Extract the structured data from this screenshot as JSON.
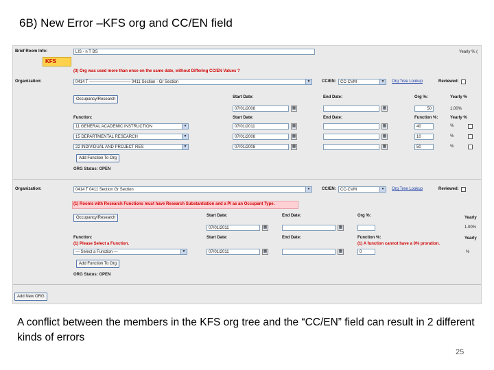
{
  "slide": {
    "title": "6B)   New Error –KFS org and CC/EN field",
    "caption": "A conflict between the members in the KFS org tree and the “CC/EN” field can result in 2 different kinds of errors",
    "page_number": "25"
  },
  "form": {
    "brief_room_info_label": "Brief Room Info:",
    "brief_room_info_value": "LIS - n T BS",
    "kfs_tag": "KFS",
    "yearly_partial": "Yearly % (",
    "section1": {
      "error": "(3) Org was used more than once on the same date, without Differing CC/EN Values  ?",
      "org_label": "Organization:",
      "org_value": "0414 T —————————— 0411 Section - Gr Section",
      "cc_label": "CC/EN:",
      "cc_value": "CC-CVM",
      "tree_link": "Org Tree Lookup",
      "reviewed_label": "Reviewed:",
      "occupancy_button": "Occupancy/Research",
      "start_date_label": "Start Date:",
      "end_date_label": "End Date:",
      "org_pct_label": "Org %:",
      "yearly_label": "Yearly %",
      "start_date_value": "07/01/2008",
      "org_pct_value": "50",
      "yearly_value": "1.00%",
      "function_label": "Function:",
      "func_start_label": "Start Date:",
      "func_end_label": "End Date:",
      "function_pct_label": "Function %:",
      "function_yearly_label": "Yearly %",
      "functions": [
        {
          "name": "11 GENERAL ACADEMIC INSTRUCTION",
          "start": "07/01/2011",
          "pct": "40",
          "yearly": "%"
        },
        {
          "name": "15 DEPARTMENTAL RESEARCH",
          "start": "07/01/2008",
          "pct": "10",
          "yearly": "%"
        },
        {
          "name": "22 INDIVIDUAL AND PROJECT RES",
          "start": "07/01/2008",
          "pct": "50",
          "yearly": "%"
        }
      ],
      "add_function_button": "Add Function To Org",
      "org_status": "ORG Status: OPEN"
    },
    "section2": {
      "org_label": "Organization:",
      "org_value": "0414 T              0411 Section  Gr Section",
      "cc_label": "CC/EN:",
      "cc_value": "CC-CVM",
      "tree_link": "Org Tree Lookup",
      "reviewed_label": "Reviewed:",
      "error": "(1) Rooms with Research Functions must have Research Substantiation and a PI as an Occupant Type.",
      "occupancy_button": "Occupancy/Research",
      "start_date_label": "Start Date:",
      "end_date_label": "End Date:",
      "org_pct_label": "Org %:",
      "yearly_label": "Yearly",
      "start_date_value": "07/01/2011",
      "yearly_value": "1.00%",
      "function_label": "Function:",
      "func_start_label": "Start Date:",
      "func_end_label": "End Date:",
      "function_pct_label": "Function %:",
      "function_yearly_label": "Yearly",
      "function_error": "(1) Please Select a Function.",
      "function_pct_error": "(1) A function cannot have a 0% proration.",
      "function_select": "— Select a Function —",
      "function_start": "07/01/2011",
      "function_pct": "0",
      "function_yearly": "%",
      "add_function_button": "Add Function To Org",
      "org_status": "ORG Status: OPEN"
    },
    "add_new_org_button": "Add New ORG"
  }
}
